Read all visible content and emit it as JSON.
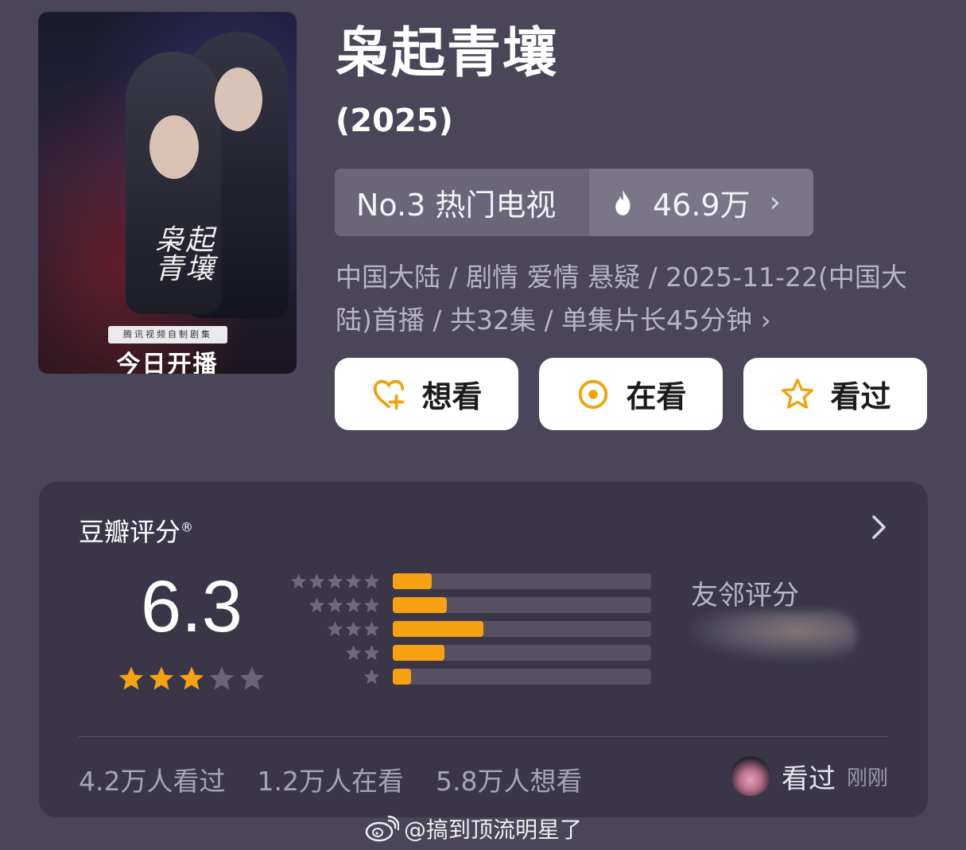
{
  "poster": {
    "calligraphy": "枭起青壤",
    "strip_text": "腾讯视频自制剧集",
    "today_text": "今日开播"
  },
  "title": "枭起青壤",
  "year": "(2025)",
  "rank": {
    "label": "No.3 热门电视",
    "heat": "46.9万"
  },
  "meta": {
    "line": "中国大陆 / 剧情 爱情 悬疑 / 2025-11-22(中国大陆)首播 / 共32集 / 单集片长45分钟"
  },
  "actions": {
    "want": "想看",
    "watching": "在看",
    "watched": "看过"
  },
  "accent_color": "#f5a111",
  "rating": {
    "title": "豆瓣评分",
    "reg_mark": "®",
    "score": "6.3",
    "stars_filled": 3,
    "stars_total": 5,
    "distribution": [
      {
        "stars": 5,
        "fraction": 0.15
      },
      {
        "stars": 4,
        "fraction": 0.21
      },
      {
        "stars": 3,
        "fraction": 0.35
      },
      {
        "stars": 2,
        "fraction": 0.2
      },
      {
        "stars": 1,
        "fraction": 0.07
      }
    ],
    "neighbor_label": "友邻评分"
  },
  "stats": {
    "watched": "4.2万人看过",
    "watching": "1.2万人在看",
    "want": "5.8万人想看"
  },
  "recent": {
    "action": "看过",
    "time": "刚刚"
  },
  "watermark": "@搞到顶流明星了"
}
